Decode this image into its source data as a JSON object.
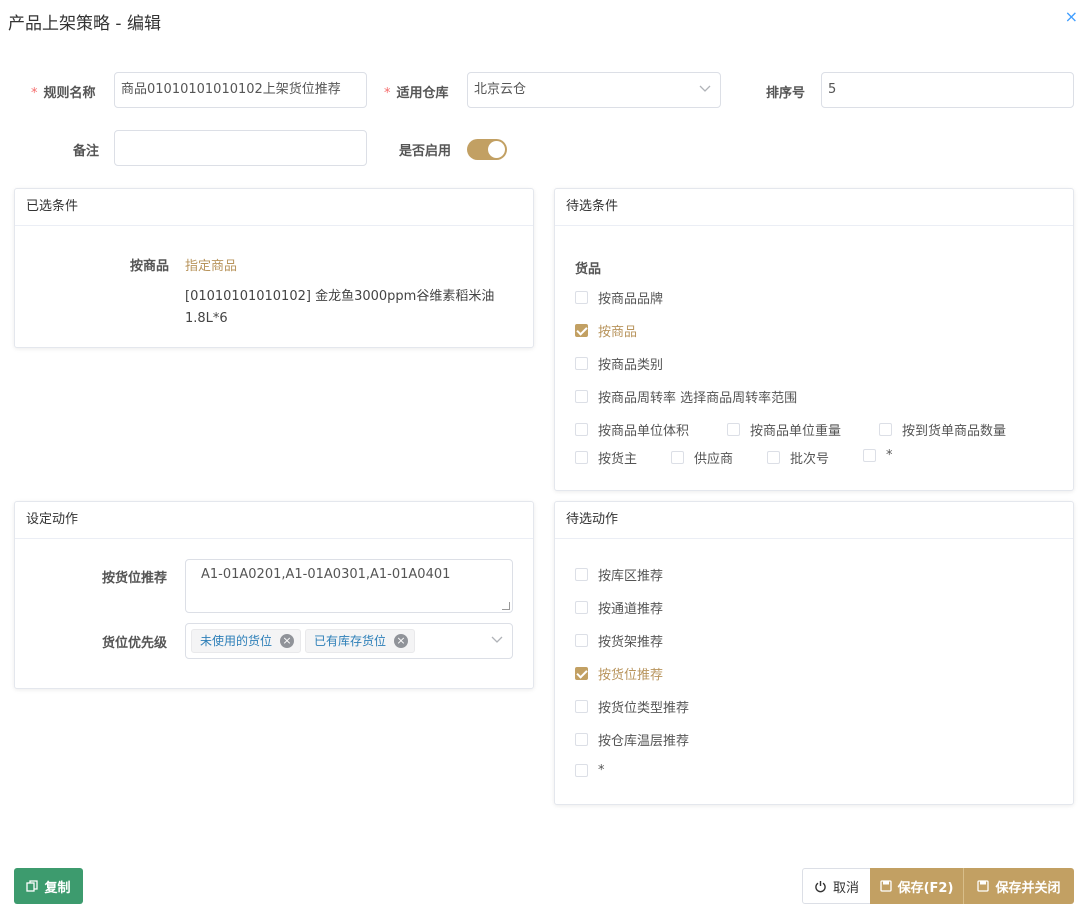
{
  "dialog": {
    "title": "产品上架策略 - 编辑",
    "close_icon": "×"
  },
  "form": {
    "rule_name_label": "规则名称",
    "rule_name_value": "商品01010101010102上架货位推荐",
    "warehouse_label": "适用仓库",
    "warehouse_value": "北京云仓",
    "sort_label": "排序号",
    "sort_value": "5",
    "remark_label": "备注",
    "remark_value": "",
    "enabled_label": "是否启用",
    "enabled": true,
    "required_mark": "*"
  },
  "selected_conditions": {
    "title": "已选条件",
    "row_label": "按商品",
    "link": "指定商品",
    "product_line1": "[01010101010102] 金龙鱼3000ppm谷维素稻米油",
    "product_line2": "1.8L*6"
  },
  "pending_conditions": {
    "title": "待选条件",
    "group_title": "货品",
    "items": [
      {
        "label": "按商品品牌",
        "checked": false
      },
      {
        "label": "按商品",
        "checked": true
      },
      {
        "label": "按商品类别",
        "checked": false
      },
      {
        "label": "按商品周转率 选择商品周转率范围",
        "checked": false
      },
      {
        "label": "按商品单位体积",
        "checked": false
      },
      {
        "label": "按商品单位重量",
        "checked": false
      },
      {
        "label": "按到货单商品数量",
        "checked": false
      },
      {
        "label": "按货主",
        "checked": false
      },
      {
        "label": "供应商",
        "checked": false
      },
      {
        "label": "批次号",
        "checked": false
      },
      {
        "label": "*",
        "checked": false
      }
    ]
  },
  "set_action": {
    "title": "设定动作",
    "location_label": "按货位推荐",
    "location_value": "A1-01A0201,A1-01A0301,A1-01A0401",
    "priority_label": "货位优先级",
    "tags": [
      "未使用的货位",
      "已有库存货位"
    ]
  },
  "pending_actions": {
    "title": "待选动作",
    "items": [
      {
        "label": "按库区推荐",
        "checked": false
      },
      {
        "label": "按通道推荐",
        "checked": false
      },
      {
        "label": "按货架推荐",
        "checked": false
      },
      {
        "label": "按货位推荐",
        "checked": true
      },
      {
        "label": "按货位类型推荐",
        "checked": false
      },
      {
        "label": "按仓库温层推荐",
        "checked": false
      },
      {
        "label": "*",
        "checked": false
      }
    ]
  },
  "footer": {
    "copy_label": "复制",
    "cancel_label": "取消",
    "save_label": "保存(F2)",
    "save_close_label": "保存并关闭"
  },
  "colors": {
    "accent": "#c2a063",
    "green": "#3d9b6e",
    "required": "#f56c6c",
    "link": "#409eff"
  }
}
